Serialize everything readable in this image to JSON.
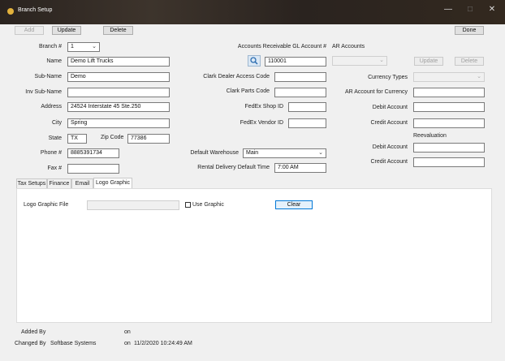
{
  "window": {
    "title": "Branch Setup",
    "minimize": "—",
    "maximize": "□",
    "close": "✕"
  },
  "toolbar": {
    "add": "Add",
    "update": "Update",
    "delete": "Delete",
    "done": "Done"
  },
  "form": {
    "branch_label": "Branch #",
    "branch_value": "1",
    "name_label": "Name",
    "name_value": "Demo Lift Trucks",
    "subname_label": "Sub-Name",
    "subname_value": "Demo",
    "invsubname_label": "Inv Sub-Name",
    "invsubname_value": "",
    "address_label": "Address",
    "address_value": "24524 Interstate 45 Ste.250",
    "city_label": "City",
    "city_value": "Spring",
    "state_label": "State",
    "state_value": "TX",
    "zip_label": "Zip Code",
    "zip_value": "77386",
    "phone_label": "Phone #",
    "phone_value": "8885391734",
    "fax_label": "Fax #",
    "fax_value": ""
  },
  "middle": {
    "ar_gl_label": "Accounts Receivable GL Account #",
    "ar_gl_value": "110001",
    "clark_dealer_label": "Clark Dealer Access Code",
    "clark_dealer_value": "",
    "clark_parts_label": "Clark Parts Code",
    "clark_parts_value": "",
    "fedex_shop_label": "FedEx Shop ID",
    "fedex_shop_value": "",
    "fedex_vendor_label": "FedEx Vendor ID",
    "fedex_vendor_value": "",
    "default_warehouse_label": "Default Warehouse",
    "default_warehouse_value": "Main",
    "rental_time_label": "Rental Delivery Default Time",
    "rental_time_value": "7:00 AM"
  },
  "ar": {
    "title": "AR Accounts",
    "dropdown_value": "",
    "update": "Update",
    "delete": "Delete",
    "currency_types_label": "Currency Types",
    "currency_types_value": "",
    "ar_currency_label": "AR Account for Currency",
    "ar_currency_value": "",
    "debit_label": "Debit Account",
    "debit_value": "",
    "credit_label": "Credit Account",
    "credit_value": "",
    "revaluation_label": "Reevaluation",
    "reval_debit_label": "Debit Account",
    "reval_debit_value": "",
    "reval_credit_label": "Credit Account",
    "reval_credit_value": ""
  },
  "tabs": [
    "Tax Setups",
    "Finance",
    "Email",
    "Logo Graphic"
  ],
  "logo": {
    "file_label": "Logo Graphic File",
    "file_value": "",
    "use_graphic_label": "Use Graphic",
    "clear": "Clear"
  },
  "footer": {
    "added_by_label": "Added By",
    "added_by_value": "",
    "added_on_label": "on",
    "added_on_value": "",
    "changed_by_label": "Changed By",
    "changed_by_value": "Softbase Systems",
    "changed_on_label": "on",
    "changed_on_value": "11/2/2020 10:24:49 AM"
  },
  "colors": {
    "accent": "#0078d7",
    "titlebar": "#2a231f"
  }
}
